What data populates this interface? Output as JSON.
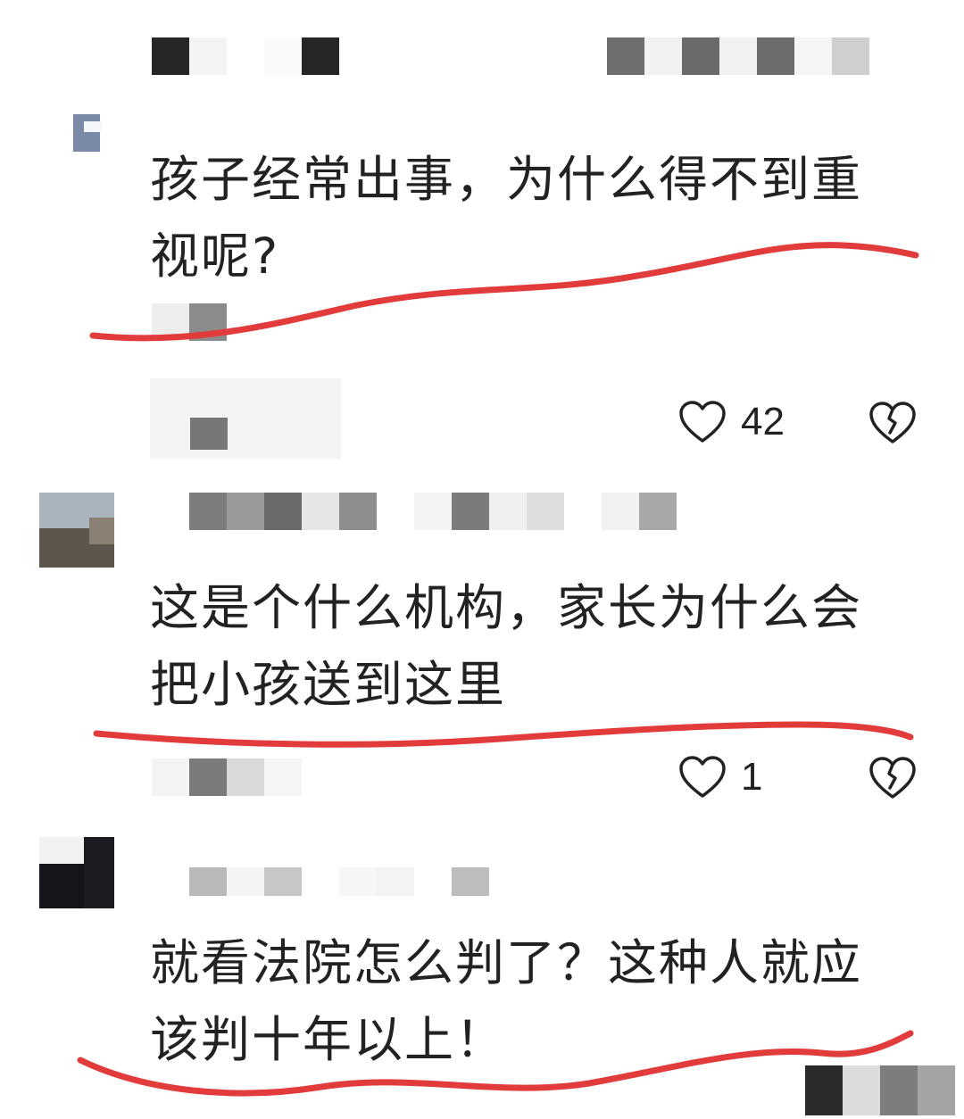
{
  "comments": [
    {
      "text": "孩子经常出事，为什么得不到重视呢?",
      "like_count": "42"
    },
    {
      "text": "这是个什么机构，家长为什么会把小孩送到这里",
      "like_count": "1"
    },
    {
      "text": "就看法院怎么判了？这种人就应该判十年以上！",
      "like_count": ""
    }
  ],
  "colors": {
    "underline": "#e23b3b",
    "mosaic_dark": "#2a2a2a",
    "mosaic_mid": "#7a7a7a",
    "mosaic_light": "#d4d4d4"
  },
  "icons": {
    "like": "heart-outline-icon",
    "dislike": "broken-heart-icon"
  }
}
